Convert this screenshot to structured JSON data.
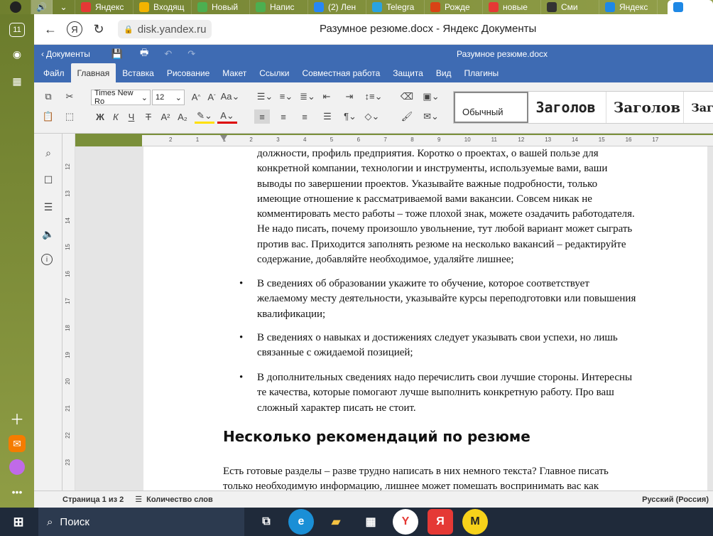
{
  "browser_tabs": [
    {
      "label": "Яндекс",
      "icon": "yandex-icon",
      "color": "#e53935"
    },
    {
      "label": "Входящ",
      "icon": "gmail-icon",
      "color": "#f4b400"
    },
    {
      "label": "Новый",
      "icon": "evernote-icon",
      "color": "#4caf50"
    },
    {
      "label": "Напис",
      "icon": "evernote-icon",
      "color": "#4caf50"
    },
    {
      "label": "(2) Лен",
      "icon": "vk-icon",
      "color": "#2787f5"
    },
    {
      "label": "Telegra",
      "icon": "telegram-icon",
      "color": "#2aa3e0"
    },
    {
      "label": "Рожде",
      "icon": "ball-icon",
      "color": "#d84315"
    },
    {
      "label": "новые",
      "icon": "yandex-icon",
      "color": "#e53935"
    },
    {
      "label": "Сми",
      "icon": "news-icon",
      "color": "#333333"
    },
    {
      "label": "Яндекс",
      "icon": "disk-icon",
      "color": "#1e88e5"
    }
  ],
  "left_rail": {
    "badge": "11"
  },
  "browser": {
    "url": "disk.yandex.ru",
    "page_title": "Разумное резюме.docx - Яндекс Документы"
  },
  "app": {
    "back_label": "Документы",
    "file_title": "Разумное резюме.docx",
    "menu_tabs": [
      "Файл",
      "Главная",
      "Вставка",
      "Рисование",
      "Макет",
      "Ссылки",
      "Совместная работа",
      "Защита",
      "Вид",
      "Плагины"
    ],
    "active_tab": "Главная",
    "font_name": "Times New Ro",
    "font_size": "12",
    "styles": [
      "Обычный",
      "Заголов",
      "Заголов",
      "Заг"
    ]
  },
  "ruler": {
    "ticks": [
      "2",
      "1",
      "1",
      "2",
      "3",
      "4",
      "5",
      "6",
      "7",
      "8",
      "9",
      "10",
      "11",
      "12",
      "13",
      "14",
      "15",
      "16",
      "17"
    ],
    "vticks": [
      "12",
      "13",
      "14",
      "15",
      "16",
      "17",
      "18",
      "19",
      "20",
      "21",
      "22",
      "23"
    ]
  },
  "document": {
    "para1_lines": [
      "должности, профиль предприятия. Коротко о проектах, о вашей пользе для",
      "конкретной компании, технологии и инструменты, используемые вами, ваши",
      "выводы по завершении проектов. Указывайте важные подробности, только",
      "имеющие отношение к рассматриваемой вами вакансии. Совсем никак не",
      "комментировать место работы – тоже плохой знак, можете озадачить работодателя.",
      "Не надо писать, почему произошло увольнение, тут любой вариант может сыграть",
      "против вас. Приходится заполнять резюме на несколько вакансий – редактируйте",
      "содержание, добавляйте необходимое, удаляйте лишнее;"
    ],
    "bullet_char": "•",
    "bullet1_lines": [
      "В сведениях об образовании укажите то обучение, которое соответствует",
      "желаемому месту деятельности, указывайте курсы переподготовки или повышения",
      "квалификации;"
    ],
    "bullet2_lines": [
      "В сведениях о навыках и достижениях следует указывать свои успехи, но лишь",
      "связанные с ожидаемой позицией;"
    ],
    "bullet3_lines": [
      "В дополнительных сведениях надо перечислить свои лучшие стороны. Интересны",
      "те качества, которые помогают лучше выполнить конкретную работу. Про ваш",
      "сложный характер писать не стоит."
    ],
    "heading": "Несколько рекомендаций по резюме",
    "para2_lines": [
      "Есть готовые разделы – разве трудно написать в них немного текста? Главное писать",
      "только необходимую информацию, лишнее может помешать воспринимать вас как"
    ]
  },
  "status": {
    "page": "Страница 1 из 2",
    "word_count": "Количество слов",
    "language": "Русский (Россия)"
  },
  "taskbar": {
    "search_label": "Поиск"
  }
}
